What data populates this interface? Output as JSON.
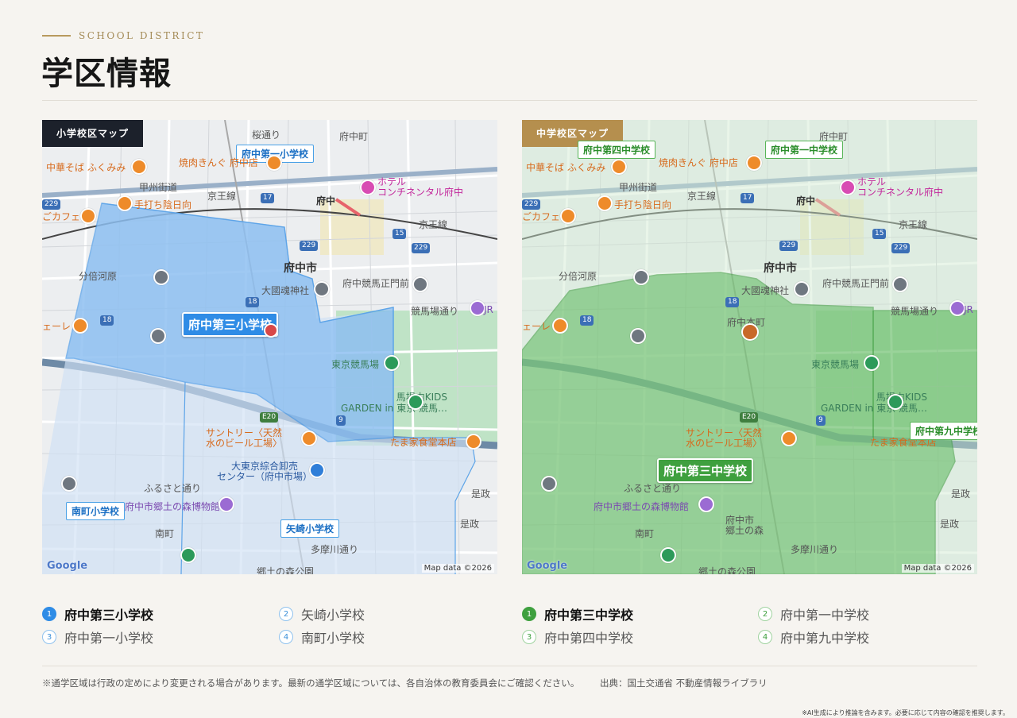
{
  "header": {
    "eyebrow": "SCHOOL DISTRICT",
    "title": "学区情報"
  },
  "colors": {
    "elementary_accent": "#2f8ce6",
    "junior_high_accent": "#3fa03f",
    "gold": "#b58f4e"
  },
  "maps": {
    "elementary": {
      "tag": "小学校区マップ",
      "main_school": "府中第三小学校",
      "school_labels": [
        "府中第一小学校",
        "南町小学校",
        "矢崎小学校"
      ],
      "places": {
        "sakura": "桜通り",
        "fuchu_cho": "府中町",
        "yakiniku": "焼肉きんぐ 府中店",
        "chuka": "中華そば ふくみみ",
        "koshu": "甲州街道",
        "keio1": "京王線",
        "hotel": "ホテル\nコンチネンタル府中",
        "fuchu_st": "府中",
        "teuchi": "手打ち陰日向",
        "cafe": "ごカフェ",
        "keio2": "京王線",
        "fuchu_shi": "府中市",
        "bunbai": "分倍河原",
        "okunitama": "大國魂神社",
        "seimon": "府中競馬正門前",
        "keiba_dori": "競馬場通り",
        "tokyo_keiba": "東京競馬場",
        "umaba": "馬場内KIDS\nGARDEN in 東京 競馬…",
        "suntory": "サントリー〈天然\n水のビール工場〉",
        "tamaya": "たま家食堂本店",
        "daitokyo": "大東京綜合卸売\nセンター（府中市場）",
        "furusato": "ふるさと通り",
        "kyodo": "府中市郷土の森博物館",
        "minamimachi": "南町",
        "tamagawa": "多摩川通り",
        "kore": "是政",
        "jr": "JR",
        "kyodo_park": "郷土の森公園",
        "eru": "ェーレ"
      },
      "google": "Google",
      "mapdata": "Map data ©2026"
    },
    "junior_high": {
      "tag": "中学校区マップ",
      "main_school": "府中第三中学校",
      "school_labels": [
        "府中第四中学校",
        "府中第一中学校",
        "府中第九中学校"
      ],
      "places": {
        "fuchu_cho": "府中町",
        "yakiniku": "焼肉きんぐ 府中店",
        "chuka": "中華そば ふくみみ",
        "koshu": "甲州街道",
        "keio1": "京王線",
        "hotel": "ホテル\nコンチネンタル府中",
        "fuchu_st": "府中",
        "teuchi": "手打ち陰日向",
        "cafe": "ごカフェ",
        "keio2": "京王線",
        "fuchu_shi": "府中市",
        "bunbai": "分倍河原",
        "okunitama": "大國魂神社",
        "seimon": "府中競馬正門前",
        "keiba_dori": "競馬場通り",
        "tokyo_keiba": "東京競馬場",
        "umaba": "馬場内KIDS\nGARDEN in 東京 競馬…",
        "suntory": "サントリー〈天然\n水のビール工場〉",
        "tamaya": "たま家食堂本店",
        "kyodo": "府中市郷土の森博物館",
        "furusato": "ふるさと通り",
        "minamimachi": "南町",
        "kyodo_mori": "府中市\n郷土の森",
        "tamagawa": "多摩川通り",
        "kore": "是政",
        "jr": "JR",
        "kyodo_park": "郷土の森公園",
        "motomachi": "府中本町",
        "eru": "ェーレ"
      },
      "google": "Google",
      "mapdata": "Map data ©2026"
    }
  },
  "lists": {
    "elementary": [
      {
        "num": "1",
        "name": "府中第三小学校",
        "active": true
      },
      {
        "num": "2",
        "name": "矢崎小学校",
        "active": false
      },
      {
        "num": "3",
        "name": "府中第一小学校",
        "active": false
      },
      {
        "num": "4",
        "name": "南町小学校",
        "active": false
      }
    ],
    "junior_high": [
      {
        "num": "1",
        "name": "府中第三中学校",
        "active": true
      },
      {
        "num": "2",
        "name": "府中第一中学校",
        "active": false
      },
      {
        "num": "3",
        "name": "府中第四中学校",
        "active": false
      },
      {
        "num": "4",
        "name": "府中第九中学校",
        "active": false
      }
    ]
  },
  "footer": {
    "note": "※通学区域は行政の定めにより変更される場合があります。最新の通学区域については、各自治体の教育委員会にご確認ください。",
    "source": "出典：国土交通省 不動産情報ライブラリ",
    "disclaimer": "※AI生成により推論を含みます。必要に応じて内容の確認を推奨します。"
  }
}
